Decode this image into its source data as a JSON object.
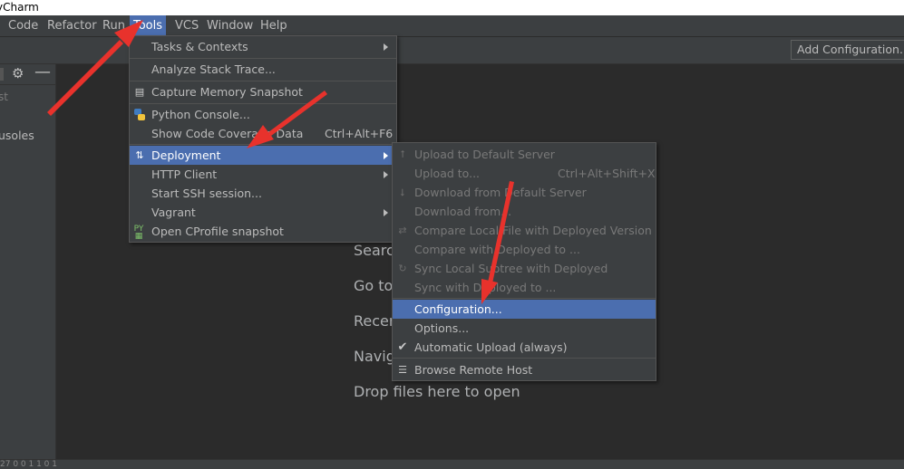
{
  "window": {
    "title": "yCharm"
  },
  "menubar": {
    "items": [
      "Code",
      "Refactor",
      "Run",
      "Tools",
      "VCS",
      "Window",
      "Help"
    ]
  },
  "toolbar": {
    "add_configuration": "Add Configuration..."
  },
  "left_panel": {
    "text1": "st",
    "text2": "usoles"
  },
  "editor_hints": [
    "Searc",
    "Go to",
    "Recer",
    "Navig",
    "Drop files here to open"
  ],
  "status": {
    "text": "27 0 0 1 1 0 1"
  },
  "tools_menu": {
    "items": [
      {
        "label": "Tasks & Contexts",
        "submenu": true
      },
      {
        "label": "Analyze Stack Trace..."
      },
      {
        "label": "Capture Memory Snapshot",
        "icon": "memory-snapshot-icon"
      },
      {
        "label": "Python Console...",
        "icon": "python-icon"
      },
      {
        "label": "Show Code Coverage Data",
        "shortcut": "Ctrl+Alt+F6"
      },
      {
        "label": "Deployment",
        "submenu": true,
        "selected": true,
        "icon": "deployment-arrows-icon"
      },
      {
        "label": "HTTP Client",
        "submenu": true
      },
      {
        "label": "Start SSH session..."
      },
      {
        "label": "Vagrant",
        "submenu": true
      },
      {
        "label": "Open CProfile snapshot",
        "icon": "cprofile-icon"
      }
    ]
  },
  "deployment_menu": {
    "items": [
      {
        "label": "Upload to Default Server",
        "disabled": true
      },
      {
        "label": "Upload to...",
        "shortcut": "Ctrl+Alt+Shift+X",
        "disabled": true
      },
      {
        "label": "Download from Default Server",
        "disabled": true
      },
      {
        "label": "Download from...",
        "disabled": true
      },
      {
        "label": "Compare Local File with Deployed Version",
        "disabled": true
      },
      {
        "label": "Compare with Deployed to ...",
        "disabled": true
      },
      {
        "label": "Sync Local Subtree with Deployed",
        "disabled": true
      },
      {
        "label": "Sync with Deployed to ...",
        "disabled": true
      },
      {
        "label": "Configuration...",
        "selected": true
      },
      {
        "label": "Options..."
      },
      {
        "label": "Automatic Upload (always)",
        "checked": true
      },
      {
        "label": "Browse Remote Host",
        "icon": "remote-host-icon"
      }
    ]
  },
  "colors": {
    "selection": "#4b6eaf",
    "annotation_arrows": "#e8322c"
  }
}
